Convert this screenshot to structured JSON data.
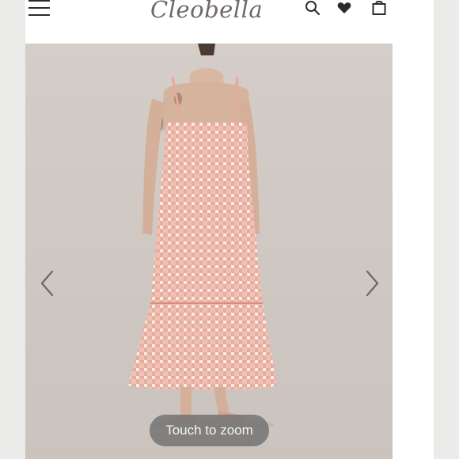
{
  "header": {
    "menu_icon": "hamburger-menu-icon",
    "logo_text": "Cleobella",
    "search_icon": "search-icon",
    "wishlist_icon": "heart-icon",
    "cart_icon": "shopping-bag-icon"
  },
  "gallery": {
    "prev_icon": "chevron-left-icon",
    "next_icon": "chevron-right-icon",
    "zoom_label": "Touch to zoom",
    "image_subject": "back view of pink gingham smocked tiered maxi dress on model"
  },
  "colors": {
    "background": "#ebebe9",
    "photo_backdrop": "#d3ccc7",
    "dress": "#e7a99b",
    "logo": "#6f6966",
    "pill": "#767473"
  }
}
